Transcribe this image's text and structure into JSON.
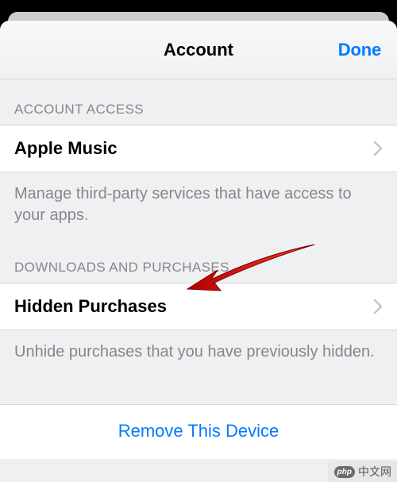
{
  "header": {
    "title": "Account",
    "done": "Done"
  },
  "sections": {
    "access": {
      "header": "ACCOUNT ACCESS",
      "row_label": "Apple Music",
      "footer": "Manage third-party services that have access to your apps."
    },
    "downloads": {
      "header": "DOWNLOADS AND PURCHASES",
      "row_label": "Hidden Purchases",
      "footer": "Unhide purchases that you have previously hidden."
    }
  },
  "remove_device": "Remove This Device",
  "watermark": {
    "logo": "php",
    "text": "中文网"
  }
}
